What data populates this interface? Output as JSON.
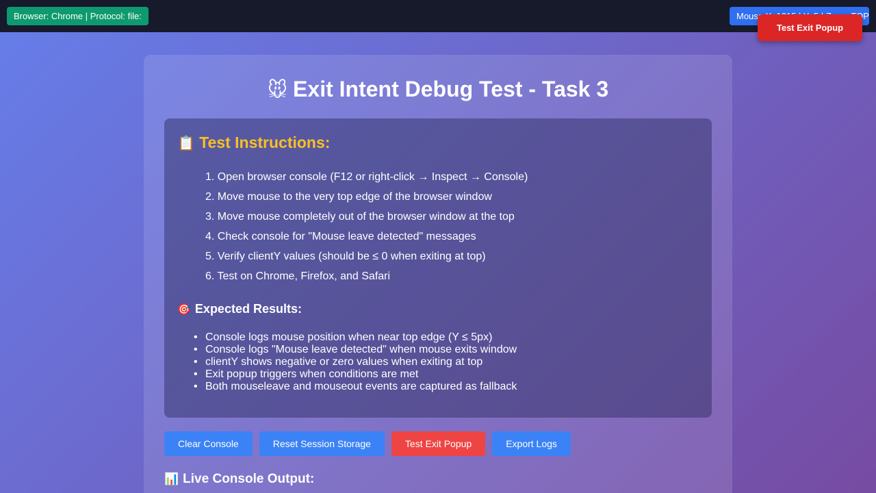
{
  "topbar": {
    "browser_info": "Browser: Chrome | Protocol: file:",
    "mouse_info": "Mouse X: 1215 | Y: 5 | Zone: TOP"
  },
  "floating_button": {
    "label": "Test Exit Popup"
  },
  "main": {
    "title_icon": "mouse-face-emoji",
    "title_emoji": "🐭",
    "title": "Exit Intent Debug Test - Task 3",
    "instructions": {
      "heading_emoji": "📋",
      "heading": "Test Instructions:",
      "steps": [
        "Open browser console (F12 or right-click → Inspect → Console)",
        "Move mouse to the very top edge of the browser window",
        "Move mouse completely out of the browser window at the top",
        "Check console for \"Mouse leave detected\" messages",
        "Verify clientY values (should be ≤ 0 when exiting at top)",
        "Test on Chrome, Firefox, and Safari"
      ],
      "expected_heading_emoji": "🎯",
      "expected_heading": "Expected Results:",
      "expected_results": [
        "Console logs mouse position when near top edge (Y ≤ 5px)",
        "Console logs \"Mouse leave detected\" when mouse exits window",
        "clientY shows negative or zero values when exiting at top",
        "Exit popup triggers when conditions are met",
        "Both mouseleave and mouseout events are captured as fallback"
      ]
    },
    "actions": [
      {
        "label": "Clear Console",
        "color": "#3b82f6"
      },
      {
        "label": "Reset Session Storage",
        "color": "#3b82f6"
      },
      {
        "label": "Test Exit Popup",
        "color": "#ef4444"
      },
      {
        "label": "Export Logs",
        "color": "#3b82f6"
      }
    ],
    "console_heading_emoji": "📊",
    "console_heading": "Live Console Output:"
  }
}
